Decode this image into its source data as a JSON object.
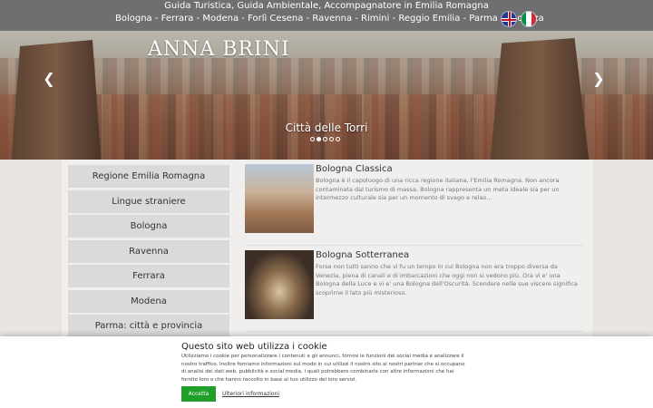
{
  "header": {
    "tagline": "Guida Turistica, Guida Ambientale, Accompagnatore in Emilia Romagna",
    "cities": "Bologna - Ferrara - Modena - Forlì Cesena - Ravenna - Rimini - Reggio Emilia - Parma -Piacenza",
    "flags": [
      "uk-flag-icon",
      "italy-flag-icon"
    ]
  },
  "hero": {
    "brand": "ANNA BRINI",
    "caption": "Città delle Torri",
    "slides_total": 5,
    "active_slide": 2
  },
  "sidebar": {
    "items": [
      {
        "label": "Regione Emilia Romagna"
      },
      {
        "label": "Lingue straniere"
      },
      {
        "label": "Bologna"
      },
      {
        "label": "Ravenna"
      },
      {
        "label": "Ferrara"
      },
      {
        "label": "Modena"
      },
      {
        "label": "Parma: città e provincia"
      }
    ]
  },
  "articles": [
    {
      "title": "Bologna Classica",
      "text": "Bologna è il capoluogo di una ricca regione italiana, l'Emilia Romagna. Non ancora contaminata dal turismo di massa, Bologna rappresenta un meta ideale sia per un intermezzo culturale sia per un momento di svago e relax..."
    },
    {
      "title": "Bologna Sotterranea",
      "text": "Forse non tutti sanno che vi fu un tempo in cui Bologna non era troppo diversa da Venezia, piena di canali e di imbarcazioni che oggi non si vedono più. Ora vi e' una Bologna della Luce e vi e' una Bologna dell'Oscurità. Scendere nelle sue viscere significa scoprirne il lato più misterioso."
    }
  ],
  "cookie": {
    "title": "Questo sito web utilizza i cookie",
    "text": "Utilizziamo i cookie per personalizzare i contenuti e gli annunci, fornire le funzioni dei social media e analizzare il nostro traffico. Inoltre forniamo informazioni sul modo in cui utilizzi il nostro sito ai nostri partner che si occupano di analisi dei dati web, pubblicità e social media, i quali potrebbero combinarle con altre informazioni che hai fornito loro o che hanno raccolto in base al tuo utilizzo dei loro servizi.",
    "accept_label": "Accetta",
    "more_label": "Ulteriori informazioni"
  },
  "colors": {
    "topbar": "#6e6f70",
    "accept": "#20a02a"
  }
}
